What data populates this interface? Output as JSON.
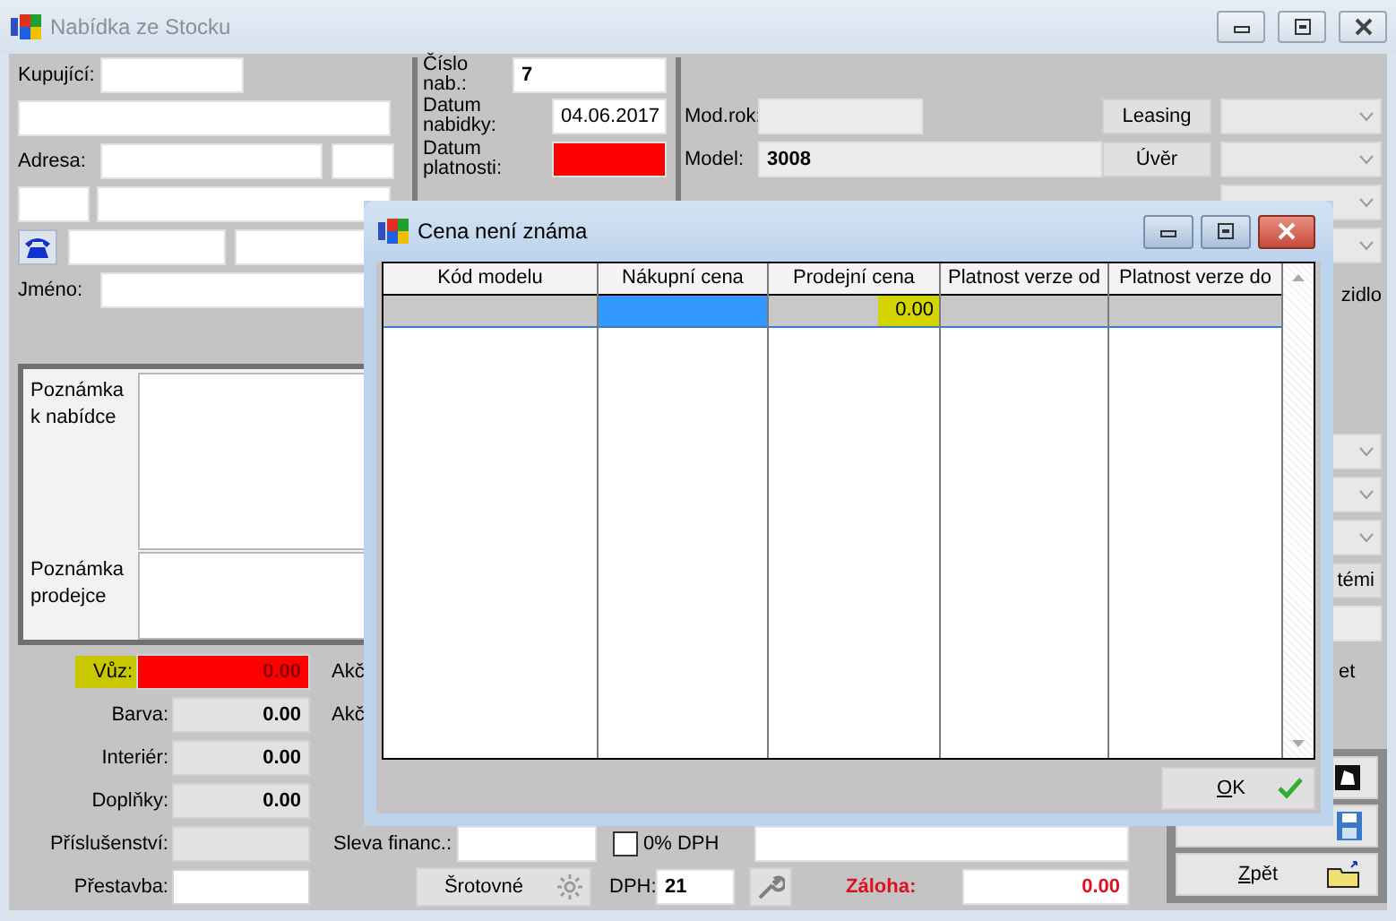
{
  "window": {
    "title": "Nabídka ze Stocku"
  },
  "customer": {
    "buyer_label": "Kupující:",
    "address_label": "Adresa:",
    "name_label": "Jméno:"
  },
  "offer": [
    {
      "label": "Číslo nab.:",
      "value": "7",
      "kind": "number",
      "invalid": false
    },
    {
      "label": "Datum nabidky:",
      "value": "04.06.2017",
      "kind": "date",
      "invalid": false
    },
    {
      "label": "Datum platnosti:",
      "kind": "date",
      "invalid": true
    }
  ],
  "vehicle": {
    "year_label": "Mod.rok:",
    "model_label": "Model:",
    "model": "3008"
  },
  "finance_buttons": [
    {
      "label": "Leasing"
    },
    {
      "label": "Úvěr"
    }
  ],
  "side": {
    "partial_label": "zidlo",
    "partial_button": "témi",
    "partial_label_2": "et"
  },
  "notes": [
    {
      "label": "Poznámka k nabídce"
    },
    {
      "label": "Poznámka prodejce"
    }
  ],
  "prices": [
    {
      "label": "Vůz:",
      "value": "0.00",
      "invalid": true,
      "highlighted": true,
      "disabled": false
    },
    {
      "label": "Barva:",
      "value": "0.00",
      "invalid": false,
      "highlighted": false,
      "disabled": true
    },
    {
      "label": "Interiér:",
      "value": "0.00",
      "invalid": false,
      "highlighted": false,
      "disabled": true
    },
    {
      "label": "Doplňky:",
      "value": "0.00",
      "invalid": false,
      "highlighted": false,
      "disabled": true
    },
    {
      "label": "Příslušenství:",
      "invalid": false,
      "highlighted": false,
      "disabled": true
    },
    {
      "label": "Přestavba:",
      "invalid": false,
      "highlighted": false,
      "disabled": false
    }
  ],
  "discount_labels": [
    "Akč",
    "Akč"
  ],
  "finance_discount": {
    "label": "Sleva financ.:"
  },
  "vat_zero": {
    "label": "0% DPH",
    "checked": false
  },
  "scrap_button": {
    "label": "Šrotovné"
  },
  "vat": {
    "label": "DPH:",
    "value": "21"
  },
  "deposit": {
    "label": "Záloha:",
    "value": "0.00"
  },
  "back_button": {
    "label": "Zpět"
  },
  "dialog": {
    "title": "Cena není známa",
    "columns": [
      "Kód modelu",
      "Nákupní cena",
      "Prodejní cena",
      "Platnost verze od",
      "Platnost verze do"
    ],
    "rows": [
      {
        "selected": true,
        "cells": [
          {
            "focused": false,
            "highlighted": false
          },
          {
            "focused": true,
            "highlighted": false
          },
          {
            "text": "0.00",
            "focused": false,
            "highlighted": true
          },
          {
            "focused": false,
            "highlighted": false
          },
          {
            "focused": false,
            "highlighted": false
          }
        ]
      }
    ],
    "ok_button": {
      "label": "OK"
    }
  }
}
